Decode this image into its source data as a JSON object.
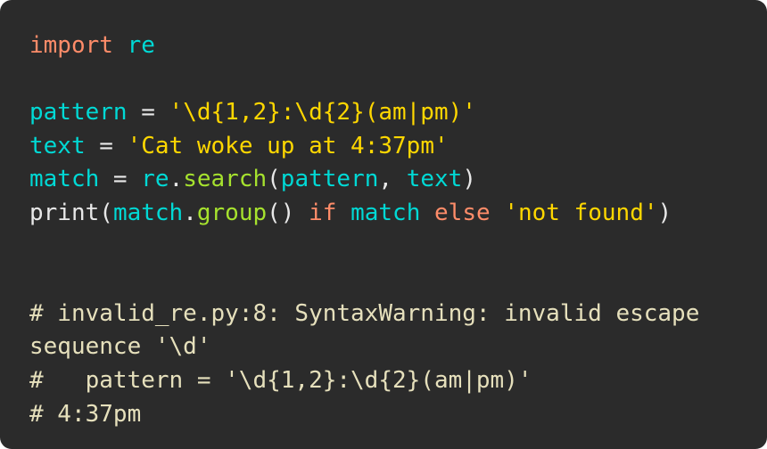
{
  "card": {
    "background_color": "#2b2b2b",
    "page_background": "#ffffff",
    "corner_radius": "13px"
  },
  "theme": {
    "keyword_color": "#ff8c69",
    "identifier_color": "#00d9d5",
    "method_color": "#a6e22e",
    "string_color": "#ffd700",
    "punctuation_color": "#e8e8e8",
    "comment_color": "#e6e0bc"
  },
  "code": {
    "language": "python",
    "lines": [
      {
        "id": "line-import",
        "tokens": [
          {
            "text": "import",
            "kind": "keyword"
          },
          {
            "text": " ",
            "kind": "punct"
          },
          {
            "text": "re",
            "kind": "name"
          }
        ]
      },
      {
        "id": "line-blank-1",
        "tokens": []
      },
      {
        "id": "line-pattern",
        "tokens": [
          {
            "text": "pattern",
            "kind": "name"
          },
          {
            "text": " = ",
            "kind": "punct"
          },
          {
            "text": "'\\d{1,2}:\\d{2}(am|pm)'",
            "kind": "string"
          }
        ]
      },
      {
        "id": "line-text",
        "tokens": [
          {
            "text": "text",
            "kind": "name"
          },
          {
            "text": " = ",
            "kind": "punct"
          },
          {
            "text": "'Cat woke up at 4:37pm'",
            "kind": "string"
          }
        ]
      },
      {
        "id": "line-match",
        "tokens": [
          {
            "text": "match",
            "kind": "name"
          },
          {
            "text": " = ",
            "kind": "punct"
          },
          {
            "text": "re",
            "kind": "name"
          },
          {
            "text": ".",
            "kind": "punct"
          },
          {
            "text": "search",
            "kind": "method"
          },
          {
            "text": "(",
            "kind": "punct"
          },
          {
            "text": "pattern",
            "kind": "name"
          },
          {
            "text": ", ",
            "kind": "punct"
          },
          {
            "text": "text",
            "kind": "name"
          },
          {
            "text": ")",
            "kind": "punct"
          }
        ]
      },
      {
        "id": "line-print",
        "tokens": [
          {
            "text": "print",
            "kind": "builtin"
          },
          {
            "text": "(",
            "kind": "punct"
          },
          {
            "text": "match",
            "kind": "name"
          },
          {
            "text": ".",
            "kind": "punct"
          },
          {
            "text": "group",
            "kind": "method"
          },
          {
            "text": "() ",
            "kind": "punct"
          },
          {
            "text": "if",
            "kind": "keyword"
          },
          {
            "text": " ",
            "kind": "punct"
          },
          {
            "text": "match",
            "kind": "name"
          },
          {
            "text": " ",
            "kind": "punct"
          },
          {
            "text": "else",
            "kind": "keyword"
          },
          {
            "text": " ",
            "kind": "punct"
          },
          {
            "text": "'not found'",
            "kind": "string"
          },
          {
            "text": ")",
            "kind": "punct"
          }
        ]
      },
      {
        "id": "line-blank-2",
        "tokens": []
      },
      {
        "id": "line-blank-3",
        "tokens": []
      },
      {
        "id": "line-comment-warning",
        "tokens": [
          {
            "text": "# invalid_re.py:8: SyntaxWarning: invalid escape sequence '\\d'",
            "kind": "comment"
          }
        ]
      },
      {
        "id": "line-comment-source",
        "tokens": [
          {
            "text": "#   pattern = '\\d{1,2}:\\d{2}(am|pm)'",
            "kind": "comment"
          }
        ]
      },
      {
        "id": "line-comment-output",
        "tokens": [
          {
            "text": "# 4:37pm",
            "kind": "comment"
          }
        ]
      }
    ]
  }
}
